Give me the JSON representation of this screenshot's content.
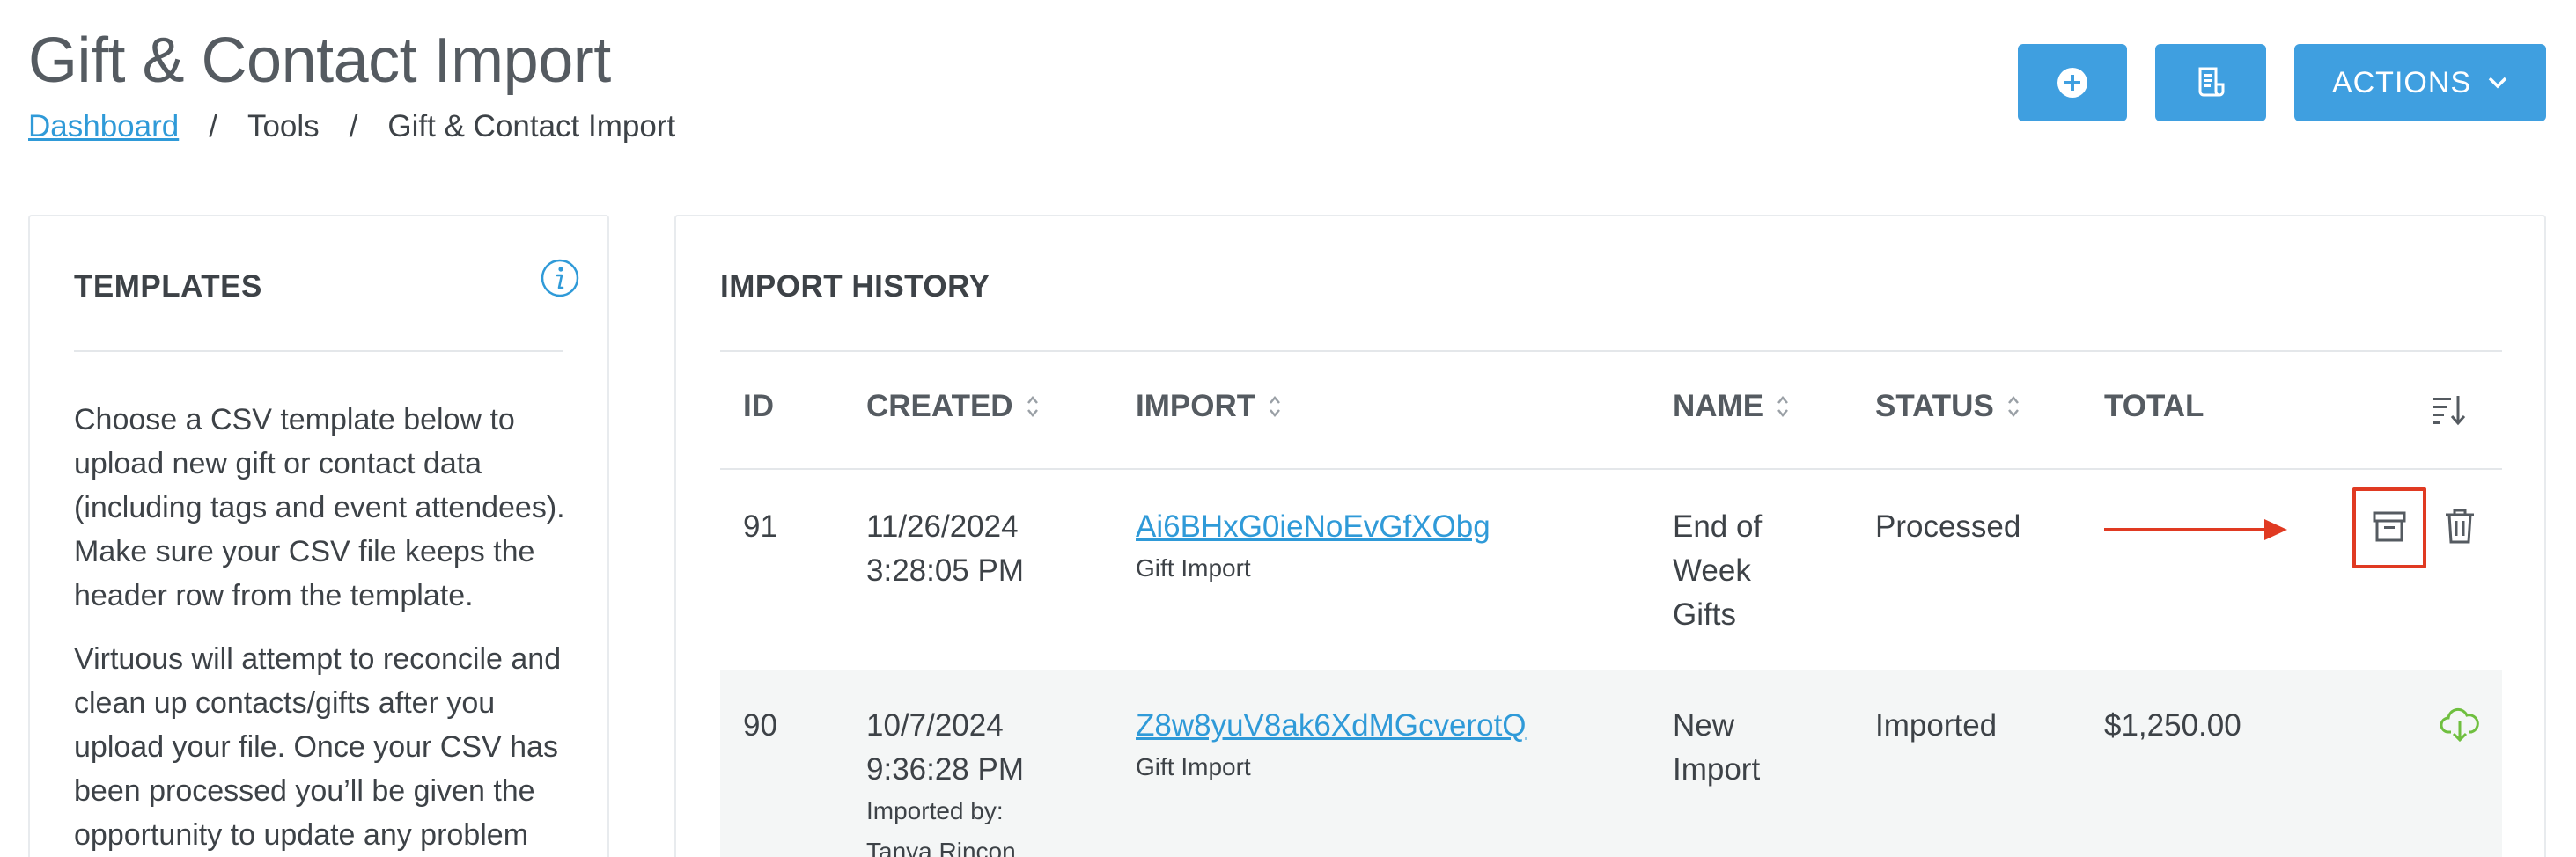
{
  "page": {
    "title": "Gift & Contact Import",
    "breadcrumb": {
      "home": "Dashboard",
      "sep": "/",
      "tools": "Tools",
      "current": "Gift & Contact Import"
    }
  },
  "header_buttons": {
    "add_icon": "plus-circle-icon",
    "report_icon": "document-icon",
    "actions_label": "ACTIONS",
    "actions_icon": "chevron-down-icon",
    "color": "#3f9fe0"
  },
  "templates_panel": {
    "heading": "TEMPLATES",
    "info_icon": "info-icon",
    "paragraph1": "Choose a CSV template below to upload new gift or contact data (including tags and event attendees). Make sure your CSV file keeps the header row from the template.",
    "paragraph2": "Virtuous will attempt to reconcile and clean up contacts/gifts after you upload your file. Once your CSV has been processed you’ll be given the opportunity to update any problem"
  },
  "history_panel": {
    "heading": "IMPORT HISTORY",
    "columns": {
      "id": "ID",
      "created": "CREATED",
      "import": "IMPORT",
      "name": "NAME",
      "status": "STATUS",
      "total": "TOTAL"
    },
    "rows": [
      {
        "id": "91",
        "created_date": "11/26/2024",
        "created_time": "3:28:05 PM",
        "import_name": "Ai6BHxG0ieNoEvGfXObg",
        "import_type": "Gift Import",
        "name_line1": "End of",
        "name_line2": "Week",
        "name_line3": "Gifts",
        "status": "Processed",
        "total": ""
      },
      {
        "id": "90",
        "created_date": "10/7/2024",
        "created_time": "9:36:28 PM",
        "imported_by_label": "Imported by:",
        "imported_by": "Tanya Rincon",
        "import_name": "Z8w8yuV8ak6XdMGcverotQ",
        "import_type": "Gift Import",
        "name_line1": "New",
        "name_line2": "Import",
        "status": "Imported",
        "total": "$1,250.00"
      }
    ]
  },
  "colors": {
    "accent": "#3f9fe0",
    "link": "#2f9ad8",
    "highlight": "#e03a22",
    "download_green": "#6fbf3f"
  }
}
